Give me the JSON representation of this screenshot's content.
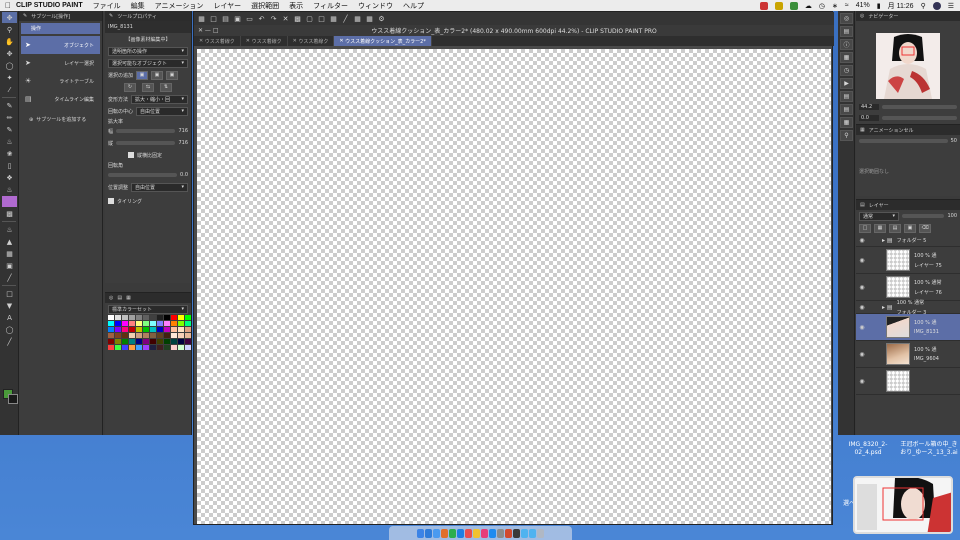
{
  "menubar": {
    "app_name": "CLIP STUDIO PAINT",
    "menus": [
      "ファイル",
      "編集",
      "アニメーション",
      "レイヤー",
      "選択範囲",
      "表示",
      "フィルター",
      "ウィンドウ",
      "ヘルプ"
    ],
    "battery": "41%",
    "clock": "月 11:26"
  },
  "subtool": {
    "title": "サブツール[操作]",
    "group_label": "操作",
    "items": [
      "オブジェクト",
      "レイヤー選択",
      "ライトテーブル",
      "タイムライン編集"
    ],
    "add_label": "サブツールを追加する"
  },
  "toolprop": {
    "title": "ツールプロパティ",
    "layer_name": "IMG_8131",
    "section_header": "【画像素材編集中】",
    "operation_dropdown": "透明箇所の操作",
    "target_dropdown": "選択可能なオブジェクト",
    "selection_mode_label": "選択の追加",
    "transform_label": "変形方法",
    "transform_value": "拡大・縮小・回",
    "rotation_center_label": "回転の中心",
    "rotation_center_value": "自由位置",
    "scale_label": "拡大率",
    "width_label": "幅",
    "width_value": "716",
    "height_label": "縦",
    "height_value": "716",
    "keep_ratio_label": "縦横比固定",
    "angle_label": "回転角",
    "angle_value": "0.0",
    "position_label": "位置調整",
    "position_value": "自由位置",
    "tiling_label": "タイリング"
  },
  "colorset": {
    "title": "標準カラーセット",
    "swatches": [
      "#ffffff",
      "#e0e0e0",
      "#c0c0c0",
      "#a0a0a0",
      "#808080",
      "#606060",
      "#404040",
      "#202020",
      "#000000",
      "#ff0000",
      "#ffff00",
      "#00ff00",
      "#00ffff",
      "#0000ff",
      "#ff00ff",
      "#ff8080",
      "#ffff80",
      "#80ff80",
      "#80ffff",
      "#8080ff",
      "#ff80ff",
      "#ff8000",
      "#80ff00",
      "#00ff80",
      "#0080ff",
      "#8000ff",
      "#ff0080",
      "#c00000",
      "#c0c000",
      "#00c000",
      "#00c0c0",
      "#0000c0",
      "#c000c0",
      "#ffc0a0",
      "#ffe0c0",
      "#e0a080",
      "#a06040",
      "#804020",
      "#603010",
      "#f0d0b0",
      "#d0a080",
      "#b08060",
      "#806040",
      "#604020",
      "#402010",
      "#ffe8d8",
      "#f8d0b8",
      "#e8b898",
      "#800000",
      "#808000",
      "#008000",
      "#008080",
      "#000080",
      "#800080",
      "#400000",
      "#404000",
      "#004000",
      "#004040",
      "#000040",
      "#400040",
      "#ff4040",
      "#40ff40",
      "#4040ff",
      "#ffa040",
      "#40a0ff",
      "#a040ff",
      "#202040",
      "#402020",
      "#204020",
      "#ffd0d0",
      "#d0ffd0",
      "#d0d0ff"
    ],
    "main_color": "#4a9a3a",
    "sub_color": "#1a1a1a"
  },
  "canvas_window": {
    "title": "ウスス着線クッション_表_カラー2* (480.02 x 490.00mm 600dpi 44.2%) - CLIP STUDIO PAINT PRO",
    "tabs": [
      "ウスス着線ク",
      "ウスス着線ク",
      "ウスス着線ク",
      "ウスス着線クッション_表_カラー2*"
    ]
  },
  "navigator": {
    "title": "ナビゲーター",
    "zoom": "44.2",
    "angle": "0.0"
  },
  "subview": {
    "title": "アニメーションセル",
    "value": "50",
    "label": "選択範囲なし"
  },
  "layers": {
    "title": "レイヤー",
    "blend_mode": "通常",
    "opacity": "100",
    "rows": [
      {
        "type": "folder",
        "name": "フォルダー 5",
        "thumb": "none"
      },
      {
        "type": "layer",
        "mode": "100 % 通",
        "name": "レイヤー 75",
        "thumb": "checker",
        "active": false
      },
      {
        "type": "layer",
        "mode": "100 % 通常",
        "name": "レイヤー 76",
        "thumb": "checker",
        "active": false
      },
      {
        "type": "folder",
        "mode": "100 % 通常",
        "name": "フォルダー 3",
        "thumb": "none"
      },
      {
        "type": "layer",
        "mode": "100 % 通",
        "name": "IMG_8131",
        "thumb": "photo",
        "active": true
      },
      {
        "type": "layer",
        "mode": "100 % 通",
        "name": "IMG_9604",
        "thumb": "photo2",
        "active": false
      },
      {
        "type": "layer",
        "mode": "",
        "name": "",
        "thumb": "checker",
        "active": false
      }
    ]
  },
  "desktop": {
    "file1": "IMG_8320_2-02_4.psd",
    "file2": "王冠ボール箱の中_きおり_ゆース_13_3.ai",
    "preview_label": "選べ"
  }
}
